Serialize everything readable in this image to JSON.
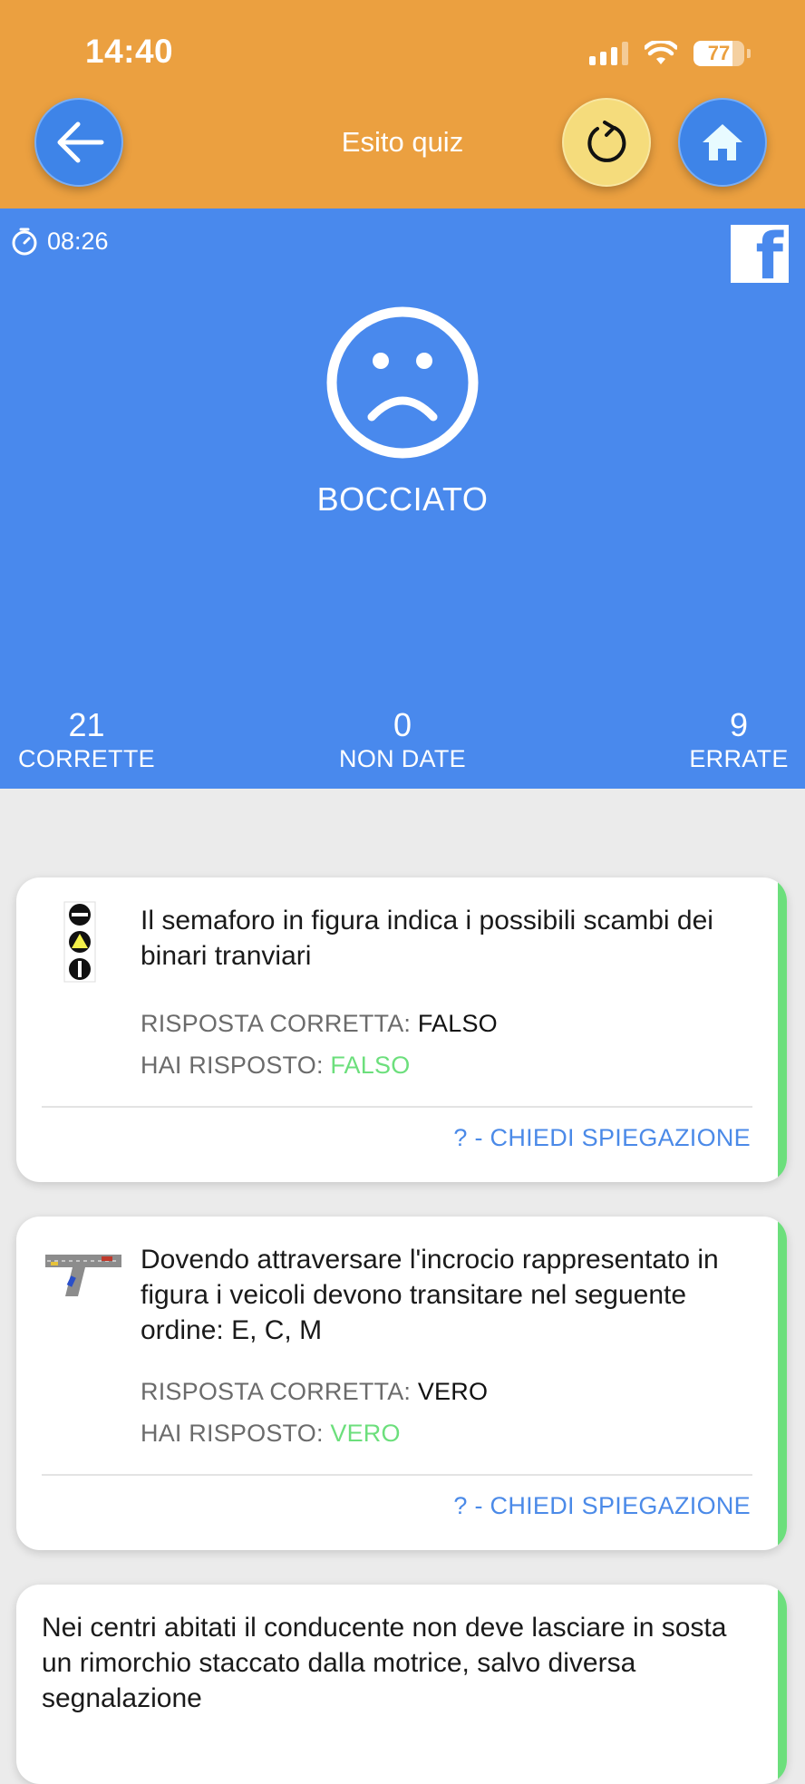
{
  "status_bar": {
    "time": "14:40",
    "battery": "77",
    "battery_level": 0.77
  },
  "header": {
    "title": "Esito quiz",
    "back_icon": "arrow-left-icon",
    "reload_icon": "refresh-icon",
    "home_icon": "home-icon"
  },
  "result": {
    "timer": "08:26",
    "share_icon": "facebook-icon",
    "verdict": "BOCCIATO",
    "stats": {
      "correct": {
        "value": "21",
        "label": "CORRETTE"
      },
      "unanswered": {
        "value": "0",
        "label": "NON DATE"
      },
      "wrong": {
        "value": "9",
        "label": "ERRATE"
      }
    }
  },
  "questions": [
    {
      "text": "Il semaforo in figura indica i possibili scambi dei binari tranviari",
      "correct_label": "RISPOSTA CORRETTA: ",
      "correct_value": "FALSO",
      "given_label": "HAI RISPOSTO: ",
      "given_value": "FALSO",
      "explain": "? - CHIEDI SPIEGAZIONE"
    },
    {
      "text": "Dovendo attraversare l'incrocio rappresentato in figura i veicoli devono transitare nel seguente ordine: E, C, M",
      "correct_label": "RISPOSTA CORRETTA: ",
      "correct_value": "VERO",
      "given_label": "HAI RISPOSTO: ",
      "given_value": "VERO",
      "explain": "? - CHIEDI SPIEGAZIONE"
    },
    {
      "text": "Nei centri abitati il conducente non deve lasciare in sosta un rimorchio staccato dalla motrice, salvo diversa segnalazione"
    }
  ]
}
